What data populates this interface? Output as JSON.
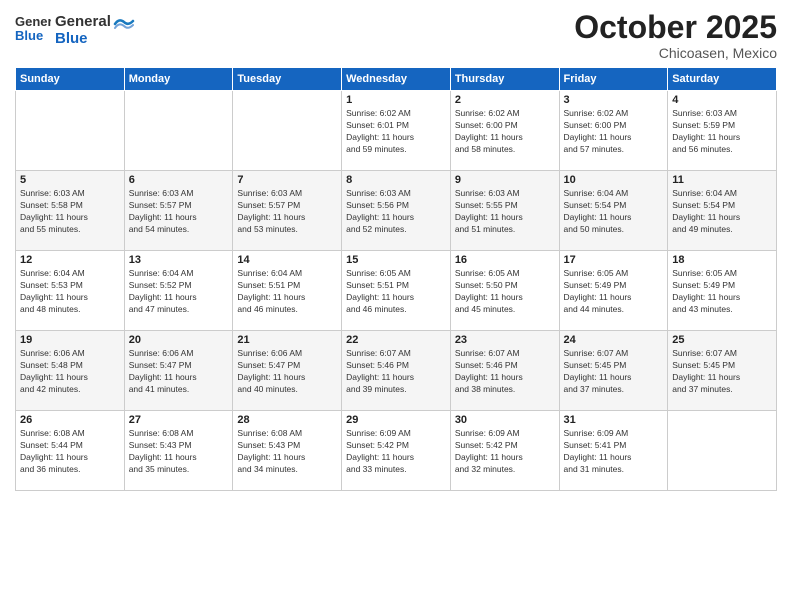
{
  "header": {
    "logo_general": "General",
    "logo_blue": "Blue",
    "month_title": "October 2025",
    "location": "Chicoasen, Mexico"
  },
  "days_of_week": [
    "Sunday",
    "Monday",
    "Tuesday",
    "Wednesday",
    "Thursday",
    "Friday",
    "Saturday"
  ],
  "weeks": [
    [
      {
        "day": "",
        "info": ""
      },
      {
        "day": "",
        "info": ""
      },
      {
        "day": "",
        "info": ""
      },
      {
        "day": "1",
        "info": "Sunrise: 6:02 AM\nSunset: 6:01 PM\nDaylight: 11 hours\nand 59 minutes."
      },
      {
        "day": "2",
        "info": "Sunrise: 6:02 AM\nSunset: 6:00 PM\nDaylight: 11 hours\nand 58 minutes."
      },
      {
        "day": "3",
        "info": "Sunrise: 6:02 AM\nSunset: 6:00 PM\nDaylight: 11 hours\nand 57 minutes."
      },
      {
        "day": "4",
        "info": "Sunrise: 6:03 AM\nSunset: 5:59 PM\nDaylight: 11 hours\nand 56 minutes."
      }
    ],
    [
      {
        "day": "5",
        "info": "Sunrise: 6:03 AM\nSunset: 5:58 PM\nDaylight: 11 hours\nand 55 minutes."
      },
      {
        "day": "6",
        "info": "Sunrise: 6:03 AM\nSunset: 5:57 PM\nDaylight: 11 hours\nand 54 minutes."
      },
      {
        "day": "7",
        "info": "Sunrise: 6:03 AM\nSunset: 5:57 PM\nDaylight: 11 hours\nand 53 minutes."
      },
      {
        "day": "8",
        "info": "Sunrise: 6:03 AM\nSunset: 5:56 PM\nDaylight: 11 hours\nand 52 minutes."
      },
      {
        "day": "9",
        "info": "Sunrise: 6:03 AM\nSunset: 5:55 PM\nDaylight: 11 hours\nand 51 minutes."
      },
      {
        "day": "10",
        "info": "Sunrise: 6:04 AM\nSunset: 5:54 PM\nDaylight: 11 hours\nand 50 minutes."
      },
      {
        "day": "11",
        "info": "Sunrise: 6:04 AM\nSunset: 5:54 PM\nDaylight: 11 hours\nand 49 minutes."
      }
    ],
    [
      {
        "day": "12",
        "info": "Sunrise: 6:04 AM\nSunset: 5:53 PM\nDaylight: 11 hours\nand 48 minutes."
      },
      {
        "day": "13",
        "info": "Sunrise: 6:04 AM\nSunset: 5:52 PM\nDaylight: 11 hours\nand 47 minutes."
      },
      {
        "day": "14",
        "info": "Sunrise: 6:04 AM\nSunset: 5:51 PM\nDaylight: 11 hours\nand 46 minutes."
      },
      {
        "day": "15",
        "info": "Sunrise: 6:05 AM\nSunset: 5:51 PM\nDaylight: 11 hours\nand 46 minutes."
      },
      {
        "day": "16",
        "info": "Sunrise: 6:05 AM\nSunset: 5:50 PM\nDaylight: 11 hours\nand 45 minutes."
      },
      {
        "day": "17",
        "info": "Sunrise: 6:05 AM\nSunset: 5:49 PM\nDaylight: 11 hours\nand 44 minutes."
      },
      {
        "day": "18",
        "info": "Sunrise: 6:05 AM\nSunset: 5:49 PM\nDaylight: 11 hours\nand 43 minutes."
      }
    ],
    [
      {
        "day": "19",
        "info": "Sunrise: 6:06 AM\nSunset: 5:48 PM\nDaylight: 11 hours\nand 42 minutes."
      },
      {
        "day": "20",
        "info": "Sunrise: 6:06 AM\nSunset: 5:47 PM\nDaylight: 11 hours\nand 41 minutes."
      },
      {
        "day": "21",
        "info": "Sunrise: 6:06 AM\nSunset: 5:47 PM\nDaylight: 11 hours\nand 40 minutes."
      },
      {
        "day": "22",
        "info": "Sunrise: 6:07 AM\nSunset: 5:46 PM\nDaylight: 11 hours\nand 39 minutes."
      },
      {
        "day": "23",
        "info": "Sunrise: 6:07 AM\nSunset: 5:46 PM\nDaylight: 11 hours\nand 38 minutes."
      },
      {
        "day": "24",
        "info": "Sunrise: 6:07 AM\nSunset: 5:45 PM\nDaylight: 11 hours\nand 37 minutes."
      },
      {
        "day": "25",
        "info": "Sunrise: 6:07 AM\nSunset: 5:45 PM\nDaylight: 11 hours\nand 37 minutes."
      }
    ],
    [
      {
        "day": "26",
        "info": "Sunrise: 6:08 AM\nSunset: 5:44 PM\nDaylight: 11 hours\nand 36 minutes."
      },
      {
        "day": "27",
        "info": "Sunrise: 6:08 AM\nSunset: 5:43 PM\nDaylight: 11 hours\nand 35 minutes."
      },
      {
        "day": "28",
        "info": "Sunrise: 6:08 AM\nSunset: 5:43 PM\nDaylight: 11 hours\nand 34 minutes."
      },
      {
        "day": "29",
        "info": "Sunrise: 6:09 AM\nSunset: 5:42 PM\nDaylight: 11 hours\nand 33 minutes."
      },
      {
        "day": "30",
        "info": "Sunrise: 6:09 AM\nSunset: 5:42 PM\nDaylight: 11 hours\nand 32 minutes."
      },
      {
        "day": "31",
        "info": "Sunrise: 6:09 AM\nSunset: 5:41 PM\nDaylight: 11 hours\nand 31 minutes."
      },
      {
        "day": "",
        "info": ""
      }
    ]
  ]
}
